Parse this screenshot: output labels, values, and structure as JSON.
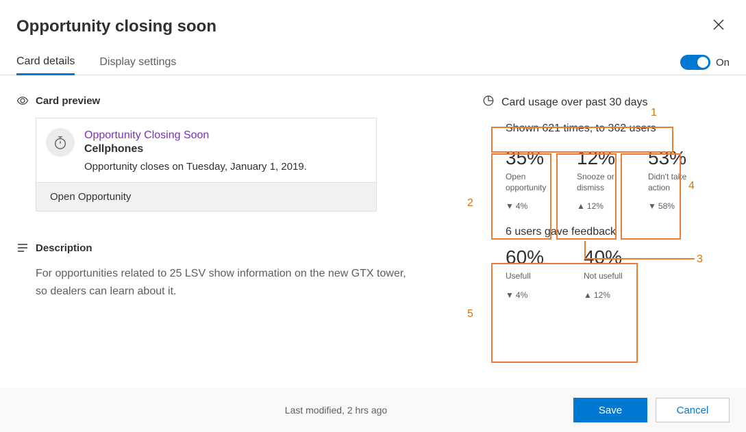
{
  "header": {
    "title": "Opportunity closing soon"
  },
  "tabs": {
    "card_details": "Card details",
    "display_settings": "Display settings",
    "toggle_label": "On"
  },
  "preview": {
    "section_title": "Card preview",
    "card_title": "Opportunity Closing Soon",
    "card_entity": "Cellphones",
    "card_desc": "Opportunity closes on Tuesday, January 1, 2019.",
    "action_label": "Open Opportunity"
  },
  "description": {
    "section_title": "Description",
    "text": "For opportunities related to 25 LSV show information on the new GTX tower, so dealers can learn about it."
  },
  "usage": {
    "section_title": "Card usage over past 30 days",
    "shown_text": "Shown 621 times, to 362 users",
    "stats": [
      {
        "pct": "35%",
        "label": "Open opportunity",
        "delta": "4%",
        "dir": "down"
      },
      {
        "pct": "12%",
        "label": "Snooze or dismiss",
        "delta": "12%",
        "dir": "up"
      },
      {
        "pct": "53%",
        "label": "Didn't take action",
        "delta": "58%",
        "dir": "down"
      }
    ],
    "feedback_text": "6 users gave feedback",
    "feedback_stats": [
      {
        "pct": "60%",
        "label": "Usefull",
        "delta": "4%",
        "dir": "down"
      },
      {
        "pct": "40%",
        "label": "Not usefull",
        "delta": "12%",
        "dir": "up"
      }
    ]
  },
  "annotations": {
    "n1": "1",
    "n2": "2",
    "n3": "3",
    "n4": "4",
    "n5": "5"
  },
  "footer": {
    "status": "Last modified, 2 hrs ago",
    "save": "Save",
    "cancel": "Cancel"
  }
}
